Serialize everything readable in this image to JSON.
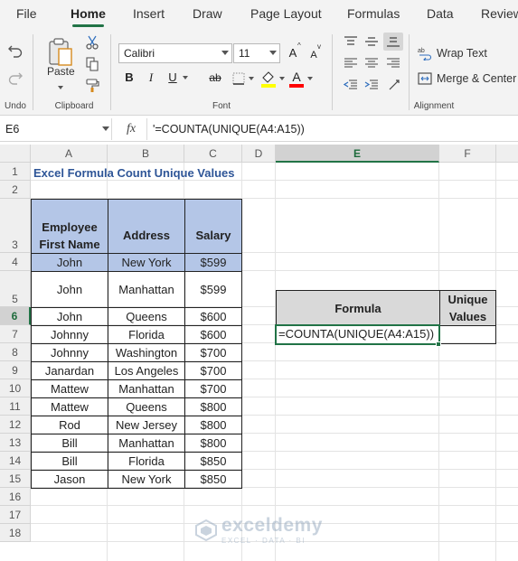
{
  "menu": {
    "items": [
      {
        "label": "File",
        "active": false
      },
      {
        "label": "Home",
        "active": true
      },
      {
        "label": "Insert",
        "active": false
      },
      {
        "label": "Draw",
        "active": false
      },
      {
        "label": "Page Layout",
        "active": false
      },
      {
        "label": "Formulas",
        "active": false
      },
      {
        "label": "Data",
        "active": false
      },
      {
        "label": "Review",
        "active": false
      }
    ]
  },
  "ribbon": {
    "undo_label": "Undo",
    "clipboard_label": "Clipboard",
    "paste_label": "Paste",
    "font_label": "Font",
    "alignment_label": "Alignment",
    "font_name": "Calibri",
    "font_size": "11",
    "bold": "B",
    "italic": "I",
    "underline": "U",
    "strike": "ab",
    "grow_font": "A",
    "shrink_font": "A",
    "font_color_letter": "A",
    "wrap_text": "Wrap Text",
    "merge_center": "Merge & Center",
    "colors": {
      "accent": "#217346",
      "highlight": "#ffff00",
      "font_color": "#ff0000"
    }
  },
  "formula_bar": {
    "name_box": "E6",
    "fx": "fx",
    "formula": "'=COUNTA(UNIQUE(A4:A15))"
  },
  "columns": [
    "A",
    "B",
    "C",
    "D",
    "E",
    "F"
  ],
  "rows": [
    "1",
    "2",
    "3",
    "4",
    "5",
    "6",
    "7",
    "8",
    "9",
    "10",
    "11",
    "12",
    "13",
    "14",
    "15",
    "16",
    "17",
    "18"
  ],
  "selected": {
    "column": "E",
    "row": "6"
  },
  "sheet": {
    "title": "Excel Formula Count Unique Values",
    "headers": {
      "name_line1": "Employee",
      "name_line2": "First Name",
      "address": "Address",
      "salary": "Salary"
    },
    "data": [
      {
        "name": "John",
        "address": "New York",
        "salary": "$599"
      },
      {
        "name": "John",
        "address": "Manhattan",
        "salary": "$599"
      },
      {
        "name": "John",
        "address": "Queens",
        "salary": "$600"
      },
      {
        "name": "Johnny",
        "address": "Florida",
        "salary": "$600"
      },
      {
        "name": "Johnny",
        "address": "Washington",
        "salary": "$700"
      },
      {
        "name": "Janardan",
        "address": "Los Angeles",
        "salary": "$700"
      },
      {
        "name": "Mattew",
        "address": "Manhattan",
        "salary": "$700"
      },
      {
        "name": "Mattew",
        "address": "Queens",
        "salary": "$800"
      },
      {
        "name": "Rod",
        "address": "New Jersey",
        "salary": "$800"
      },
      {
        "name": "Bill",
        "address": "Manhattan",
        "salary": "$800"
      },
      {
        "name": "Bill",
        "address": "Florida",
        "salary": "$850"
      },
      {
        "name": "Jason",
        "address": "New York",
        "salary": "$850"
      }
    ],
    "result_table": {
      "formula_header": "Formula",
      "unique_line1": "Unique",
      "unique_line2": "Values",
      "formula_cell": "=COUNTA(UNIQUE(A4:A15))",
      "value_cell": ""
    }
  },
  "watermark": {
    "name": "exceldemy",
    "sub": "EXCEL · DATA · BI"
  }
}
